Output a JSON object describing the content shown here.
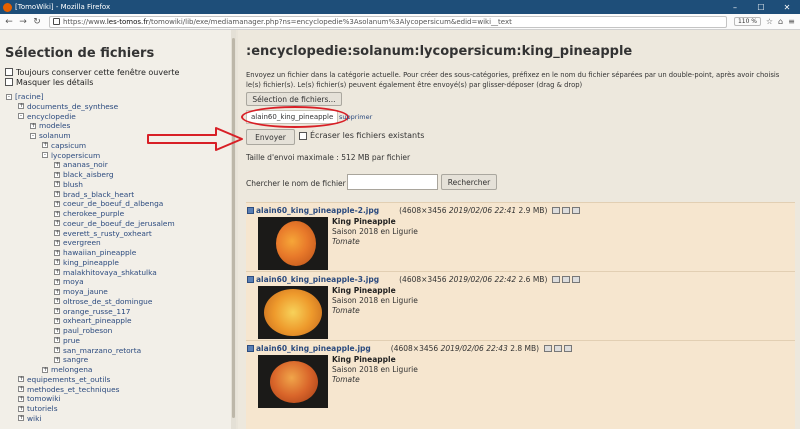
{
  "browser": {
    "window_title": "[TomoWiki] - Mozilla Firefox",
    "url_prefix": "https://www.",
    "url_host": "les-tomos.fr",
    "url_path": "/tomowiki/lib/exe/mediamanager.php?ns=encyclopedie%3Asolanum%3Alycopersicum&edid=wiki__text",
    "zoom": "110 %"
  },
  "sidebar": {
    "title": "Sélection de fichiers",
    "options": [
      "Toujours conserver cette fenêtre ouverte",
      "Masquer les détails"
    ],
    "tree": [
      {
        "label": "[racine]",
        "level": 0,
        "toggle": "-"
      },
      {
        "label": "documents_de_synthese",
        "level": 1,
        "toggle": "+"
      },
      {
        "label": "encyclopedie",
        "level": 1,
        "toggle": "-"
      },
      {
        "label": "modeles",
        "level": 2,
        "toggle": "+"
      },
      {
        "label": "solanum",
        "level": 2,
        "toggle": "-"
      },
      {
        "label": "capsicum",
        "level": 3,
        "toggle": "+"
      },
      {
        "label": "lycopersicum",
        "level": 3,
        "toggle": "-"
      },
      {
        "label": "ananas_noir",
        "level": 4,
        "toggle": "+"
      },
      {
        "label": "black_aisberg",
        "level": 4,
        "toggle": "+"
      },
      {
        "label": "blush",
        "level": 4,
        "toggle": "+"
      },
      {
        "label": "brad_s_black_heart",
        "level": 4,
        "toggle": "+"
      },
      {
        "label": "coeur_de_boeuf_d_albenga",
        "level": 4,
        "toggle": "+"
      },
      {
        "label": "cherokee_purple",
        "level": 4,
        "toggle": "+"
      },
      {
        "label": "coeur_de_boeuf_de_jerusalem",
        "level": 4,
        "toggle": "+"
      },
      {
        "label": "everett_s_rusty_oxheart",
        "level": 4,
        "toggle": "+"
      },
      {
        "label": "evergreen",
        "level": 4,
        "toggle": "+"
      },
      {
        "label": "hawaiian_pineapple",
        "level": 4,
        "toggle": "+"
      },
      {
        "label": "king_pineapple",
        "level": 4,
        "toggle": "+"
      },
      {
        "label": "malakhitovaya_shkatulka",
        "level": 4,
        "toggle": "+"
      },
      {
        "label": "moya",
        "level": 4,
        "toggle": "+"
      },
      {
        "label": "moya_jaune",
        "level": 4,
        "toggle": "+"
      },
      {
        "label": "oltrose_de_st_domingue",
        "level": 4,
        "toggle": "+"
      },
      {
        "label": "orange_russe_117",
        "level": 4,
        "toggle": "+"
      },
      {
        "label": "oxheart_pineapple",
        "level": 4,
        "toggle": "+"
      },
      {
        "label": "paul_robeson",
        "level": 4,
        "toggle": "+"
      },
      {
        "label": "prue",
        "level": 4,
        "toggle": "+"
      },
      {
        "label": "san_marzano_retorta",
        "level": 4,
        "toggle": "+"
      },
      {
        "label": "sangre",
        "level": 4,
        "toggle": "+"
      },
      {
        "label": "melongena",
        "level": 3,
        "toggle": "+"
      },
      {
        "label": "equipements_et_outils",
        "level": 1,
        "toggle": "+"
      },
      {
        "label": "methodes_et_techniques",
        "level": 1,
        "toggle": "+"
      },
      {
        "label": "tomowiki",
        "level": 1,
        "toggle": "+"
      },
      {
        "label": "tutoriels",
        "level": 1,
        "toggle": "+"
      },
      {
        "label": "wiki",
        "level": 1,
        "toggle": "+"
      }
    ]
  },
  "main": {
    "title": ":encyclopedie:solanum:lycopersicum:king_pineapple",
    "description": "Envoyez un fichier dans la catégorie actuelle. Pour créer des sous-catégories, préfixez en le nom du fichier séparées par un double-point, après avoir choisis le(s) fichier(s). Le(s) fichier(s) peuvent également être envoyé(s) par glisser-déposer (drag & drop)",
    "select_button": "Sélection de fichiers...",
    "selected_file": "alain60_king_pineapple",
    "delete_link": "supprimer",
    "send_button": "Envoyer",
    "overwrite_label": "Écraser les fichiers existants",
    "max_size": "Taille d'envoi maximale : 512 MB par fichier",
    "search_label": "Chercher le nom de fichier :",
    "search_value": "",
    "search_button": "Rechercher",
    "files": [
      {
        "name": "alain60_king_pineapple-2.jpg",
        "dims": "(4608×3456 ",
        "date": "2019/02/06 22:41",
        "size": " 2.9 MB)",
        "title": "King Pineapple",
        "desc": "Saison 2018 en Ligurie",
        "tag": "Tomate"
      },
      {
        "name": "alain60_king_pineapple-3.jpg",
        "dims": "(4608×3456 ",
        "date": "2019/02/06 22:42",
        "size": " 2.6 MB)",
        "title": "King Pineapple",
        "desc": "Saison 2018 en Ligurie",
        "tag": "Tomate"
      },
      {
        "name": "alain60_king_pineapple.jpg",
        "dims": "(4608×3456 ",
        "date": "2019/02/06 22:43",
        "size": " 2.8 MB)",
        "title": "King Pineapple",
        "desc": "Saison 2018 en Ligurie",
        "tag": "Tomate"
      }
    ]
  },
  "icons": {
    "file_actions": [
      "magnifier-icon",
      "link-icon",
      "delete-icon"
    ],
    "browser": [
      "back-icon",
      "forward-icon",
      "reload-icon",
      "home-icon",
      "bookmark-icon",
      "menu-icon"
    ]
  },
  "colors": {
    "annotation_red": "#d81f26",
    "link_blue": "#2b4a7e",
    "entry_bg": "#f6e6cf"
  }
}
